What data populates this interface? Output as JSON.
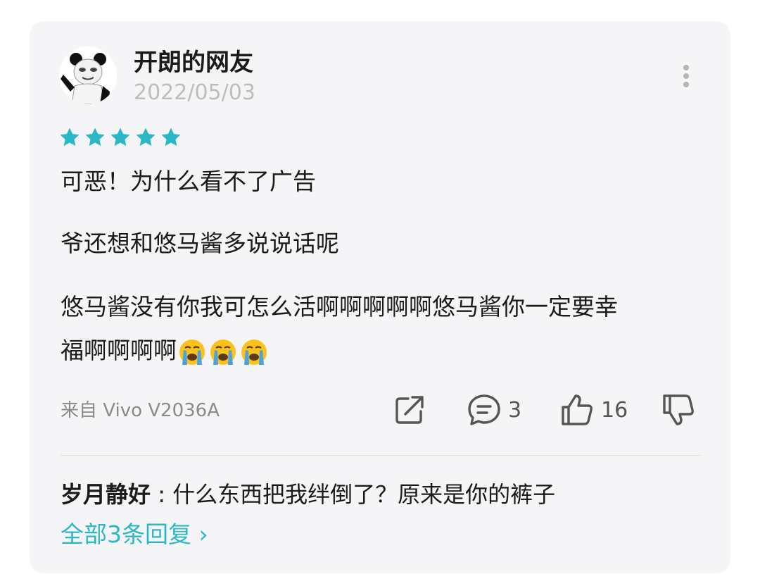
{
  "review": {
    "username": "开朗的网友",
    "date": "2022/05/03",
    "rating": 5,
    "lines": [
      "可恶！为什么看不了广告",
      "爷还想和悠马酱多说说话呢",
      "悠马酱没有你我可怎么活啊啊啊啊啊悠马酱你一定要幸",
      "福啊啊啊啊"
    ],
    "emoji": "loudly-crying-face",
    "emoji_count": 3,
    "device": "来自 Vivo V2036A"
  },
  "actions": {
    "share_icon": "share-icon",
    "comment_icon": "comment-icon",
    "comment_count": "3",
    "like_icon": "thumbs-up-icon",
    "like_count": "16",
    "dislike_icon": "thumbs-down-icon"
  },
  "reply": {
    "author": "岁月静好",
    "separator": ":",
    "text": "什么东西把我绊倒了？原来是你的裤子"
  },
  "all_replies": {
    "label": "全部3条回复",
    "chevron": "›"
  },
  "colors": {
    "accent": "#2bb8c6",
    "card_bg": "#f5f5f7",
    "text": "#1b1b1b",
    "muted": "#bdbdbd"
  }
}
